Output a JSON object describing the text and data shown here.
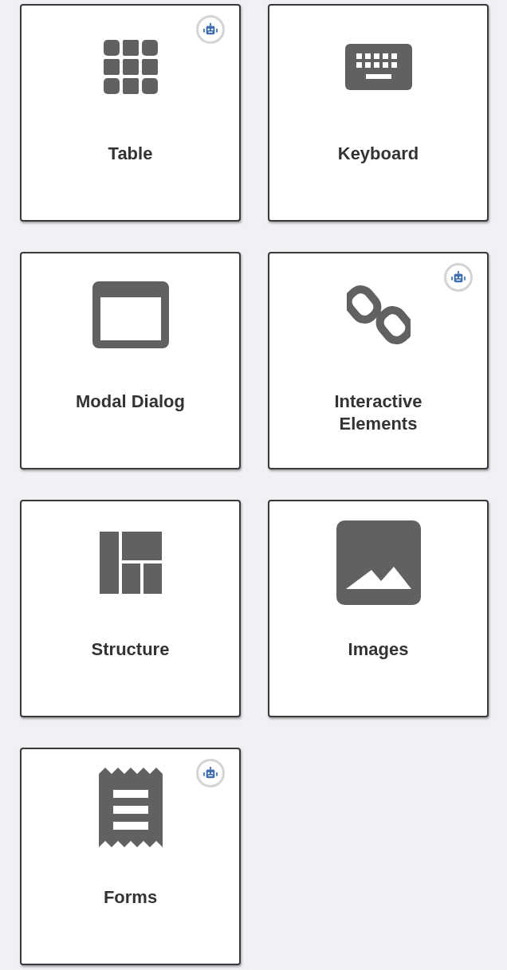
{
  "cards": [
    {
      "label": "Table",
      "kind": "table",
      "ai_badge": true
    },
    {
      "label": "Keyboard",
      "kind": "keyboard",
      "ai_badge": false
    },
    {
      "label": "Modal Dialog",
      "kind": "dialog",
      "ai_badge": false
    },
    {
      "label": "Interactive Elements",
      "kind": "link",
      "ai_badge": true
    },
    {
      "label": "Structure",
      "kind": "structure",
      "ai_badge": false
    },
    {
      "label": "Images",
      "kind": "image",
      "ai_badge": false
    },
    {
      "label": "Forms",
      "kind": "receipt",
      "ai_badge": true
    }
  ]
}
